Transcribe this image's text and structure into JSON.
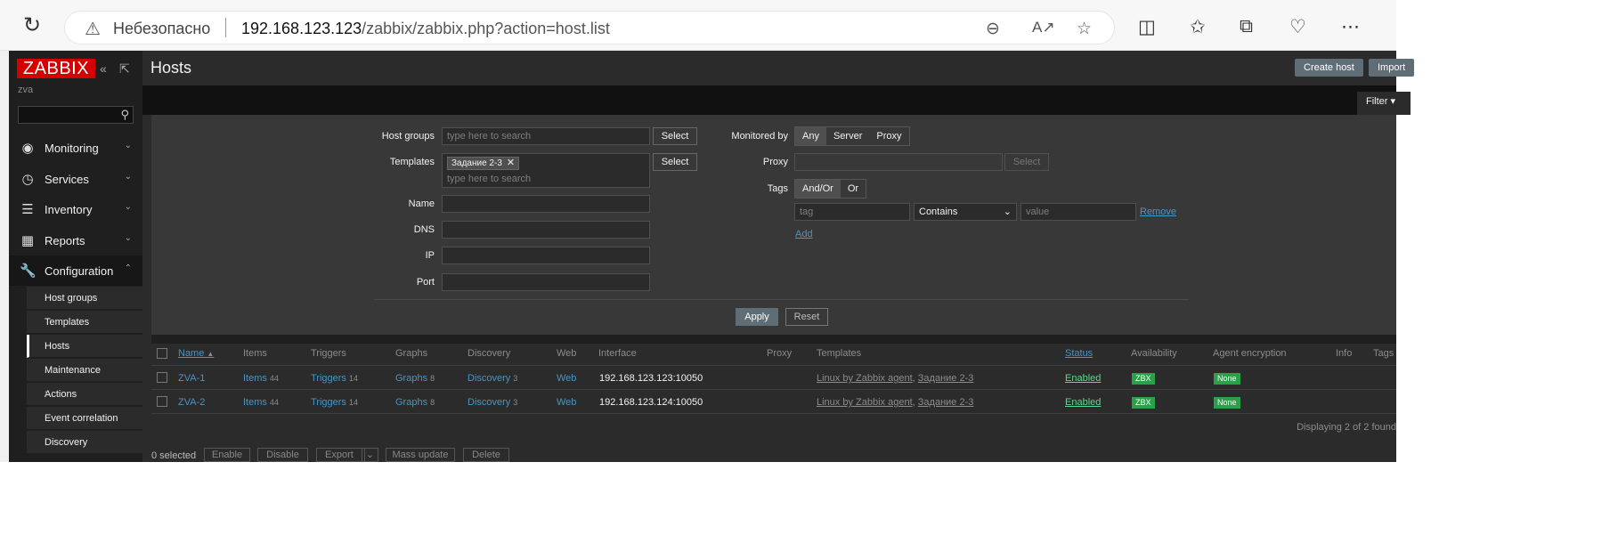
{
  "browser": {
    "security_label": "Небезопасно",
    "url_host": "192.168.123.123",
    "url_path": "/zabbix/zabbix.php?action=host.list",
    "icons": [
      "reload-icon",
      "warning-icon",
      "zoom-out-icon",
      "read-aloud-icon",
      "favorite-star-icon",
      "split-screen-icon",
      "favorites-list-icon",
      "collections-icon",
      "browser-health-icon",
      "more-menu-icon"
    ]
  },
  "sidebar": {
    "logo": "ZABBIX",
    "server_name": "zva",
    "menu": [
      {
        "label": "Monitoring",
        "icon": "eye-icon"
      },
      {
        "label": "Services",
        "icon": "stopwatch-icon"
      },
      {
        "label": "Inventory",
        "icon": "list-icon"
      },
      {
        "label": "Reports",
        "icon": "bar-chart-icon"
      },
      {
        "label": "Configuration",
        "icon": "wrench-icon"
      }
    ],
    "submenu": [
      "Host groups",
      "Templates",
      "Hosts",
      "Maintenance",
      "Actions",
      "Event correlation",
      "Discovery"
    ],
    "active_submenu": "Hosts"
  },
  "page": {
    "title": "Hosts",
    "create_host": "Create host",
    "import": "Import"
  },
  "filter": {
    "tab_label": "Filter",
    "host_groups_label": "Host groups",
    "search_placeholder": "type here to search",
    "select_label": "Select",
    "templates_label": "Templates",
    "template_chip": "Задание 2-3",
    "name_label": "Name",
    "dns_label": "DNS",
    "ip_label": "IP",
    "port_label": "Port",
    "monitored_by_label": "Monitored by",
    "monitored_options": [
      "Any",
      "Server",
      "Proxy"
    ],
    "monitored_selected": "Any",
    "proxy_label": "Proxy",
    "tags_label": "Tags",
    "tag_logic": [
      "And/Or",
      "Or"
    ],
    "tag_logic_selected": "And/Or",
    "tag_placeholder": "tag",
    "tag_operator": "Contains",
    "value_placeholder": "value",
    "remove_label": "Remove",
    "add_label": "Add",
    "apply_label": "Apply",
    "reset_label": "Reset"
  },
  "table": {
    "columns": [
      "Name",
      "Items",
      "Triggers",
      "Graphs",
      "Discovery",
      "Web",
      "Interface",
      "Proxy",
      "Templates",
      "Status",
      "Availability",
      "Agent encryption",
      "Info",
      "Tags"
    ],
    "sort_arrow": "▲",
    "rows": [
      {
        "name": "ZVA-1",
        "items": "Items",
        "items_count": "44",
        "triggers": "Triggers",
        "triggers_count": "14",
        "graphs": "Graphs",
        "graphs_count": "8",
        "discovery": "Discovery",
        "discovery_count": "3",
        "web": "Web",
        "interface": "192.168.123.123:10050",
        "template1": "Linux by Zabbix agent",
        "template2": "Задание 2-3",
        "status": "Enabled",
        "availability": "ZBX",
        "encryption": "None"
      },
      {
        "name": "ZVA-2",
        "items": "Items",
        "items_count": "44",
        "triggers": "Triggers",
        "triggers_count": "14",
        "graphs": "Graphs",
        "graphs_count": "8",
        "discovery": "Discovery",
        "discovery_count": "3",
        "web": "Web",
        "interface": "192.168.123.124:10050",
        "template1": "Linux by Zabbix agent",
        "template2": "Задание 2-3",
        "status": "Enabled",
        "availability": "ZBX",
        "encryption": "None"
      }
    ],
    "displaying": "Displaying 2 of 2 found"
  },
  "footer": {
    "selected": "0 selected",
    "buttons": [
      "Enable",
      "Disable",
      "Export",
      "Mass update",
      "Delete"
    ]
  },
  "colors": {
    "brand": "#d40000",
    "link": "#4796c4",
    "enabled": "#59db8f",
    "badge": "#2aa048",
    "primary_button": "#5f6d76"
  }
}
